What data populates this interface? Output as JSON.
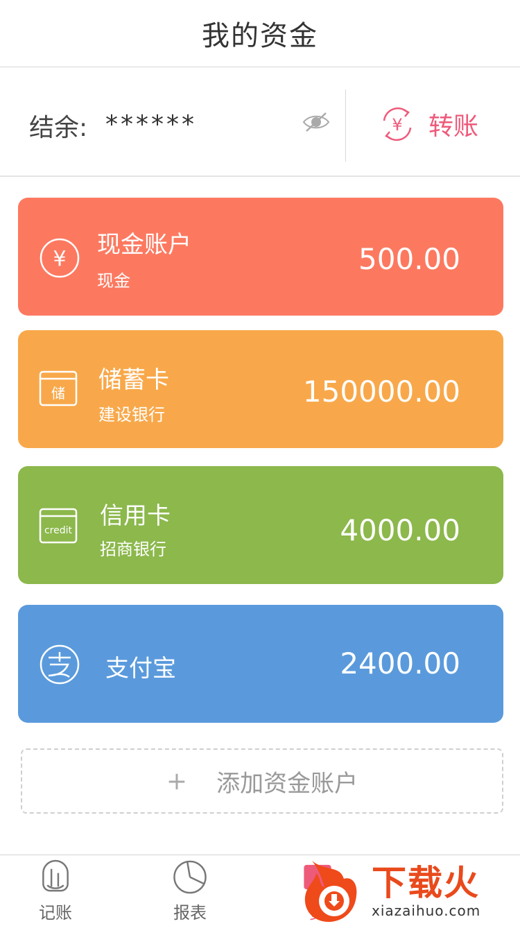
{
  "header": {
    "title": "我的资金"
  },
  "balance": {
    "label": "结余:",
    "value": "******",
    "transfer_label": "转账"
  },
  "accounts": [
    {
      "name": "现金账户",
      "sub": "现金",
      "amount": "500.00",
      "color": "#fc7960",
      "icon": "yen-circle-icon"
    },
    {
      "name": "储蓄卡",
      "sub": "建设银行",
      "amount": "150000.00",
      "color": "#f8a84a",
      "icon": "savings-card-icon",
      "icon_text": "储"
    },
    {
      "name": "信用卡",
      "sub": "招商银行",
      "amount": "4000.00",
      "color": "#8cb84c",
      "icon": "credit-card-icon",
      "icon_text": "credit"
    },
    {
      "name": "支付宝",
      "sub": "",
      "amount": "2400.00",
      "color": "#5a9adc",
      "icon": "alipay-icon"
    }
  ],
  "add_account": {
    "plus": "+",
    "label": "添加资金账户"
  },
  "tabbar": {
    "items": [
      {
        "label": "记账",
        "icon": "pencil-cup-icon"
      },
      {
        "label": "报表",
        "icon": "pie-chart-icon"
      },
      {
        "label": "资",
        "icon": "wallet-icon",
        "active": true
      }
    ]
  },
  "watermark": {
    "cn": "下载火",
    "en": "xiazaihuo.com"
  },
  "colors": {
    "accent": "#ee5a7a",
    "divider": "#d8d8d8"
  }
}
